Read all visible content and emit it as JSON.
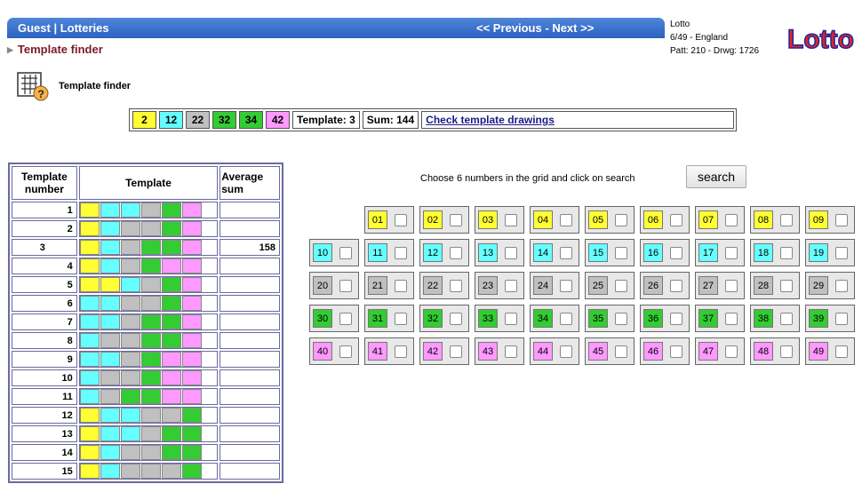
{
  "header": {
    "breadcrumb": "Guest | Lotteries",
    "previous_label": "<< Previous",
    "separator": "-",
    "next_label": "Next >>"
  },
  "page_title": "Template finder",
  "lottery_info": {
    "line1": "Lotto",
    "line2": "6/49 - England",
    "line3": "Patt: 210 - Drwg: 1726"
  },
  "logo_text": "Lotto",
  "section_label": "Template finder",
  "summary": {
    "numbers": [
      {
        "value": "2",
        "color": "#ffff33"
      },
      {
        "value": "12",
        "color": "#66ffff"
      },
      {
        "value": "22",
        "color": "#c0c0c0"
      },
      {
        "value": "32",
        "color": "#33cc33"
      },
      {
        "value": "34",
        "color": "#33cc33"
      },
      {
        "value": "42",
        "color": "#ff99ff"
      }
    ],
    "template_label": "Template: 3",
    "sum_label": "Sum: 144",
    "link_label": "Check template drawings"
  },
  "colors": {
    "yellow": "#ffff33",
    "cyan": "#66ffff",
    "gray": "#c0c0c0",
    "green": "#33cc33",
    "pink": "#ff99ff"
  },
  "table": {
    "headers": {
      "number": "Template number",
      "template": "Template",
      "avg": "Average sum"
    },
    "rows": [
      {
        "number": "1",
        "avg": "",
        "pattern": [
          "yellow",
          "cyan",
          "cyan",
          "gray",
          "green",
          "pink"
        ]
      },
      {
        "number": "2",
        "avg": "",
        "pattern": [
          "yellow",
          "cyan",
          "gray",
          "gray",
          "green",
          "pink"
        ]
      },
      {
        "number": "3",
        "avg": "158",
        "pattern": [
          "yellow",
          "cyan",
          "gray",
          "green",
          "green",
          "pink"
        ]
      },
      {
        "number": "4",
        "avg": "",
        "pattern": [
          "yellow",
          "cyan",
          "gray",
          "green",
          "pink",
          "pink"
        ]
      },
      {
        "number": "5",
        "avg": "",
        "pattern": [
          "yellow",
          "yellow",
          "cyan",
          "gray",
          "green",
          "pink"
        ]
      },
      {
        "number": "6",
        "avg": "",
        "pattern": [
          "cyan",
          "cyan",
          "gray",
          "gray",
          "green",
          "pink"
        ]
      },
      {
        "number": "7",
        "avg": "",
        "pattern": [
          "cyan",
          "cyan",
          "gray",
          "green",
          "green",
          "pink"
        ]
      },
      {
        "number": "8",
        "avg": "",
        "pattern": [
          "cyan",
          "gray",
          "gray",
          "green",
          "green",
          "pink"
        ]
      },
      {
        "number": "9",
        "avg": "",
        "pattern": [
          "cyan",
          "cyan",
          "gray",
          "green",
          "pink",
          "pink"
        ]
      },
      {
        "number": "10",
        "avg": "",
        "pattern": [
          "cyan",
          "gray",
          "gray",
          "green",
          "pink",
          "pink"
        ]
      },
      {
        "number": "11",
        "avg": "",
        "pattern": [
          "cyan",
          "gray",
          "green",
          "green",
          "pink",
          "pink"
        ]
      },
      {
        "number": "12",
        "avg": "",
        "pattern": [
          "yellow",
          "cyan",
          "cyan",
          "gray",
          "gray",
          "green"
        ]
      },
      {
        "number": "13",
        "avg": "",
        "pattern": [
          "yellow",
          "cyan",
          "cyan",
          "gray",
          "green",
          "green"
        ]
      },
      {
        "number": "14",
        "avg": "",
        "pattern": [
          "yellow",
          "cyan",
          "gray",
          "gray",
          "green",
          "green"
        ]
      },
      {
        "number": "15",
        "avg": "",
        "pattern": [
          "yellow",
          "cyan",
          "gray",
          "gray",
          "gray",
          "green"
        ]
      }
    ]
  },
  "instruction": "Choose 6 numbers in the grid and click on search",
  "search_label": "search",
  "grid_rows": [
    {
      "color": "yellow",
      "numbers": [
        "01",
        "02",
        "03",
        "04",
        "05",
        "06",
        "07",
        "08",
        "09"
      ]
    },
    {
      "color": "cyan",
      "numbers": [
        "10",
        "11",
        "12",
        "13",
        "14",
        "15",
        "16",
        "17",
        "18",
        "19"
      ]
    },
    {
      "color": "gray",
      "numbers": [
        "20",
        "21",
        "22",
        "23",
        "24",
        "25",
        "26",
        "27",
        "28",
        "29"
      ]
    },
    {
      "color": "green",
      "numbers": [
        "30",
        "31",
        "32",
        "33",
        "34",
        "35",
        "36",
        "37",
        "38",
        "39"
      ]
    },
    {
      "color": "pink",
      "numbers": [
        "40",
        "41",
        "42",
        "43",
        "44",
        "45",
        "46",
        "47",
        "48",
        "49"
      ]
    }
  ]
}
